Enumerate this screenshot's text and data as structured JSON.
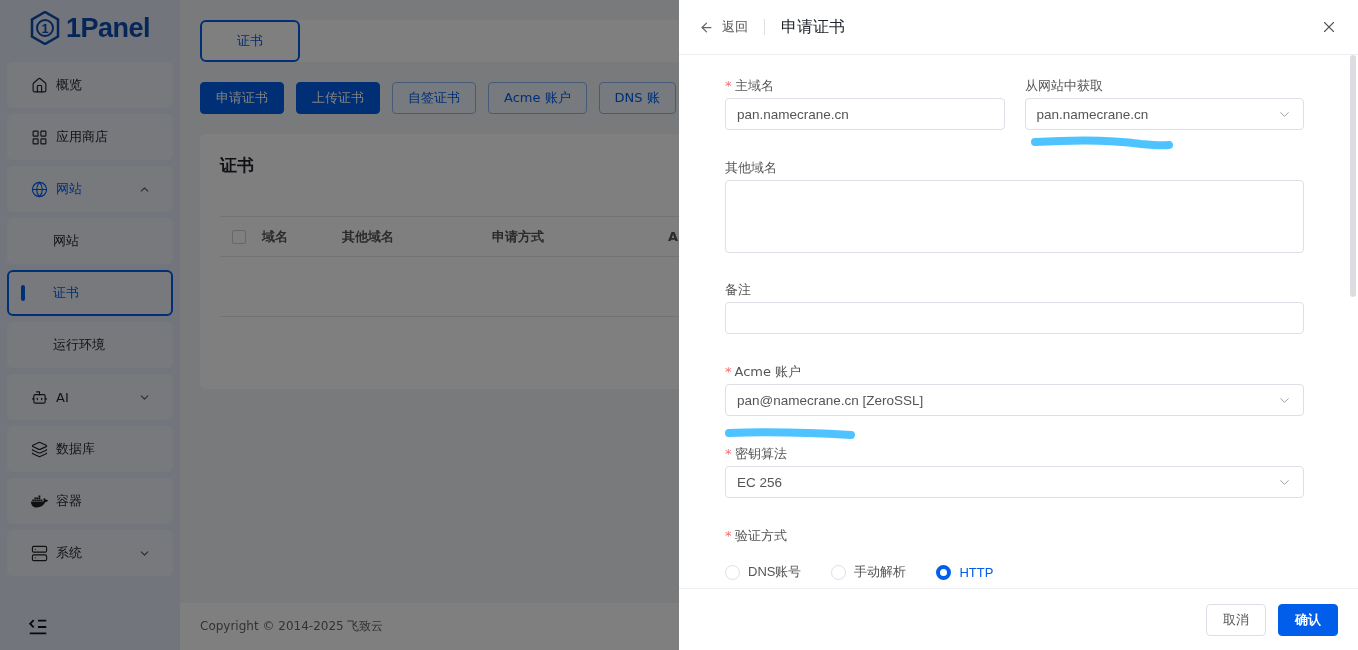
{
  "sidebar": {
    "logo": {
      "mark": "1",
      "name": "1Panel"
    },
    "items": [
      {
        "label": "概览",
        "selected": false
      },
      {
        "label": "应用商店",
        "selected": false
      },
      {
        "label": "网站",
        "selected": false,
        "expanded": true,
        "children": [
          {
            "label": "网站",
            "selected": false
          },
          {
            "label": "证书",
            "selected": true
          },
          {
            "label": "运行环境",
            "selected": false
          }
        ]
      },
      {
        "label": "AI",
        "selected": false,
        "expanded": false
      },
      {
        "label": "数据库",
        "selected": false
      },
      {
        "label": "容器",
        "selected": false
      },
      {
        "label": "系统",
        "selected": false,
        "expanded": false
      }
    ]
  },
  "page": {
    "tabs": [
      {
        "label": "证书",
        "selected": true
      }
    ],
    "toolbar": [
      {
        "label": "申请证书",
        "kind": "primary"
      },
      {
        "label": "上传证书",
        "kind": "primary"
      },
      {
        "label": "自签证书",
        "kind": "outline"
      },
      {
        "label": "Acme 账户",
        "kind": "outline"
      },
      {
        "label": "DNS 账",
        "kind": "outline"
      }
    ],
    "card": {
      "title": "证书",
      "select_all": {
        "checked": false
      },
      "columns": [
        "域名",
        "其他域名",
        "申请方式",
        "A"
      ]
    },
    "footer": "Copyright © 2014-2025 飞致云"
  },
  "drawer": {
    "back": "返回",
    "title": "申请证书",
    "rows": [
      [
        {
          "kind": "input",
          "required_mark": "*",
          "label": "主域名",
          "value": "pan.namecrane.cn"
        },
        {
          "kind": "select",
          "label": "从网站中获取",
          "value": "pan.namecrane.cn"
        }
      ],
      [
        {
          "kind": "textarea",
          "label": "其他域名"
        }
      ],
      [
        {
          "kind": "input",
          "label": "备注"
        }
      ],
      [
        {
          "kind": "select",
          "required_mark": "*",
          "label": "Acme 账户",
          "value": "pan@namecrane.cn [ZeroSSL]"
        }
      ],
      [
        {
          "kind": "select",
          "required_mark": "*",
          "label": "密钥算法",
          "value": "EC 256"
        }
      ],
      [
        {
          "kind": "radio",
          "required_mark": "*",
          "label": "验证方式",
          "options": [
            {
              "label": "DNS账号",
              "selected": false
            },
            {
              "label": "手动解析",
              "selected": false
            },
            {
              "label": "HTTP",
              "selected": true
            }
          ]
        }
      ]
    ],
    "buttons": [
      {
        "label": "取消",
        "kind": "default"
      },
      {
        "label": "确认",
        "kind": "primary"
      }
    ]
  }
}
